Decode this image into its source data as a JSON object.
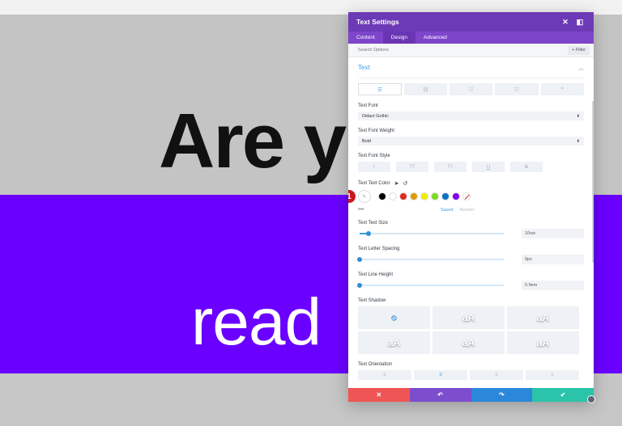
{
  "page": {
    "headline": "Are yo",
    "subline": "read"
  },
  "modal": {
    "title": "Text Settings",
    "tabs": [
      {
        "label": "Content"
      },
      {
        "label": "Design"
      },
      {
        "label": "Advanced"
      }
    ],
    "search_placeholder": "Search Options",
    "filter_label": "+ Filter",
    "section_title": "Text",
    "font_label": "Text Font",
    "font_value": "Didact Gothic",
    "weight_label": "Text Font Weight",
    "weight_value": "Bold",
    "style_label": "Text Font Style",
    "style_options": [
      "I",
      "TT",
      "Tт",
      "U",
      "S"
    ],
    "color_label": "Text Text Color",
    "swatch_colors": [
      "#000000",
      "#ffffff",
      "#e02b20",
      "#e09900",
      "#edf000",
      "#7cda24",
      "#0c71c3",
      "#8300e9"
    ],
    "badge_number": "1",
    "color_more": "•••",
    "saved_label": "Saved",
    "recent_label": "Recent",
    "size_label": "Text Text Size",
    "size_value": "10vw",
    "size_fraction": 0.06,
    "spacing_label": "Text Letter Spacing",
    "spacing_value": "0px",
    "spacing_fraction": 0.0,
    "lineheight_label": "Text Line Height",
    "lineheight_value": "0.9em",
    "lineheight_fraction": 0.0,
    "shadow_label": "Text Shadow",
    "shadow_cells": [
      "⦸",
      "aA",
      "aA",
      "aA",
      "aA",
      "aA"
    ],
    "orientation_label": "Text Orientation",
    "orientation_options": [
      "≡",
      "≡",
      "≡",
      "≡"
    ],
    "accent_color": "#3aa0e8",
    "footer_colors": [
      "#ef5555",
      "#7c4dcc",
      "#2b87da",
      "#29c4a9"
    ]
  }
}
